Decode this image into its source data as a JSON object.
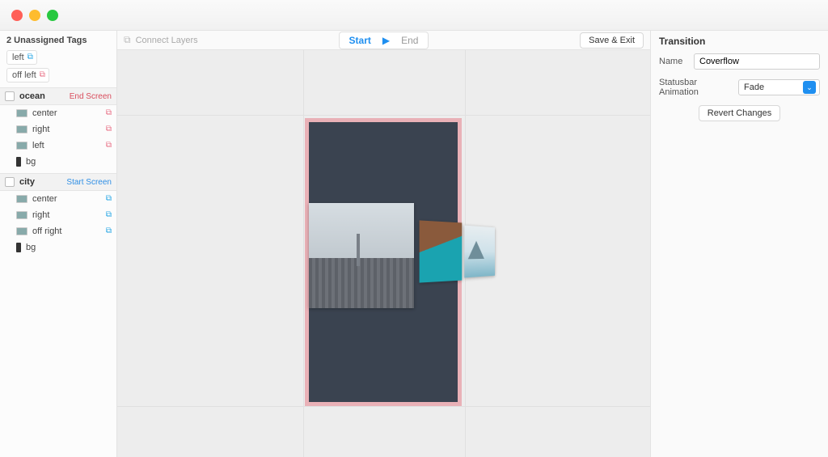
{
  "sidebar": {
    "unassigned_header": "2 Unassigned Tags",
    "unassigned": [
      {
        "label": "left",
        "link_color": "blue"
      },
      {
        "label": "off left",
        "link_color": "pink"
      }
    ],
    "screens": [
      {
        "name": "ocean",
        "role_label": "End Screen",
        "role_kind": "end",
        "layers": [
          {
            "name": "center",
            "link": "pink",
            "thumb": "img"
          },
          {
            "name": "right",
            "link": "pink",
            "thumb": "img"
          },
          {
            "name": "left",
            "link": "pink",
            "thumb": "img"
          },
          {
            "name": "bg",
            "link": null,
            "thumb": "bg"
          }
        ]
      },
      {
        "name": "city",
        "role_label": "Start Screen",
        "role_kind": "start",
        "layers": [
          {
            "name": "center",
            "link": "blue",
            "thumb": "img"
          },
          {
            "name": "right",
            "link": "blue",
            "thumb": "img"
          },
          {
            "name": "off right",
            "link": "blue",
            "thumb": "img"
          },
          {
            "name": "bg",
            "link": null,
            "thumb": "bg"
          }
        ]
      }
    ]
  },
  "toolbar": {
    "connect_layers": "Connect Layers",
    "start": "Start",
    "end": "End",
    "save_exit": "Save & Exit"
  },
  "inspector": {
    "title": "Transition",
    "name_label": "Name",
    "name_value": "Coverflow",
    "statusbar_label": "Statusbar Animation",
    "statusbar_value": "Fade",
    "revert": "Revert Changes"
  }
}
